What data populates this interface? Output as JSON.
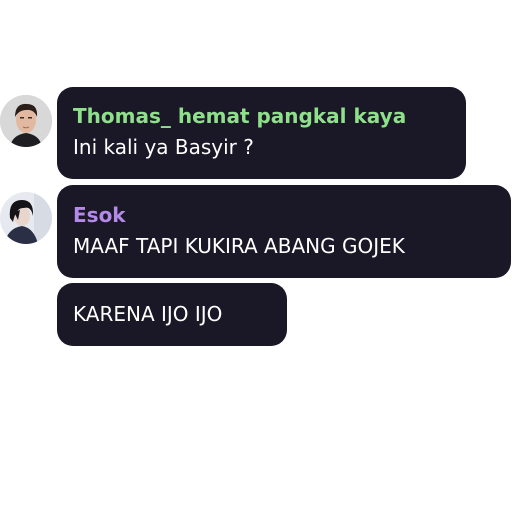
{
  "messages": [
    {
      "sender": "Thomas_ hemat pangkal kaya",
      "sender_color": "#8ee08a",
      "text": "Ini kali ya Basyir ?",
      "avatar": "man-portrait-avatar"
    },
    {
      "sender": "Esok",
      "sender_color": "#b48ae8",
      "text": "MAAF TAPI KUKIRA ABANG GOJEK",
      "avatar": "dark-hair-person-avatar"
    },
    {
      "text": "KARENA IJO IJO"
    }
  ],
  "colors": {
    "bubble_bg": "#1a1726",
    "text": "#ffffff",
    "page_bg": "#ffffff"
  }
}
